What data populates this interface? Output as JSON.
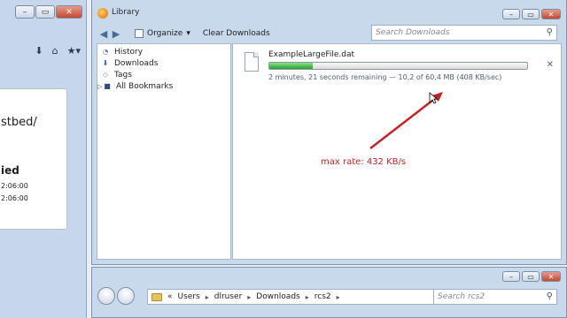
{
  "library": {
    "title": "Library",
    "toolbar": {
      "back_icon": "back-arrow",
      "forward_icon": "forward-arrow",
      "organize_label": "Organize",
      "clear_downloads_label": "Clear Downloads"
    },
    "search": {
      "placeholder": "Search Downloads"
    },
    "sidebar": [
      {
        "label": "History",
        "icon": "history-icon"
      },
      {
        "label": "Downloads",
        "icon": "downloads-icon"
      },
      {
        "label": "Tags",
        "icon": "tags-icon"
      },
      {
        "label": "All Bookmarks",
        "icon": "bookmarks-icon"
      }
    ],
    "download": {
      "filename": "ExampleLargeFile.dat",
      "progress": 0.17,
      "status": "2 minutes, 21 seconds remaining — 10,2 of 60,4 MB (408 KB/sec)"
    }
  },
  "annotation": {
    "text": "max rate: 432 KB/s",
    "color": "#c62222"
  },
  "left_window": {
    "url_fragment": "stbed/",
    "bold_fragment": "ied",
    "time_1": "2:06:00",
    "time_2": "2:06:00"
  },
  "explorer": {
    "breadcrumb_prefix": "«",
    "crumbs": [
      "Users",
      "dlruser",
      "Downloads",
      "rcs2"
    ],
    "search": {
      "placeholder": "Search rcs2"
    }
  },
  "colors": {
    "progress_fill": "#23a22a",
    "accent": "#3d5a80"
  }
}
